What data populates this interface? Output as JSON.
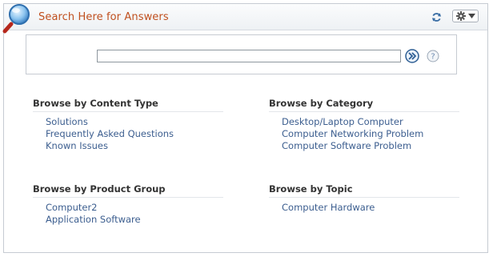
{
  "header": {
    "title": "Search Here for Answers",
    "logo_icon": "magnifier-icon",
    "refresh_icon": "refresh-icon",
    "options_icon": "gear-icon",
    "title_color": "#c0501f"
  },
  "search": {
    "value": "",
    "go_icon": "double-chevron-right-icon",
    "help_label": "?"
  },
  "sections": [
    {
      "heading": "Browse by Content Type",
      "links": [
        "Solutions",
        "Frequently Asked Questions",
        "Known Issues"
      ]
    },
    {
      "heading": "Browse by Category",
      "links": [
        "Desktop/Laptop Computer",
        "Computer Networking Problem",
        "Computer Software Problem"
      ]
    },
    {
      "heading": "Browse by Product Group",
      "links": [
        "Computer2",
        "Application Software"
      ]
    },
    {
      "heading": "Browse by Topic",
      "links": [
        "Computer Hardware"
      ]
    }
  ],
  "colors": {
    "link": "#3c5e8f",
    "heading": "#333333",
    "border": "#c6cbd2"
  }
}
